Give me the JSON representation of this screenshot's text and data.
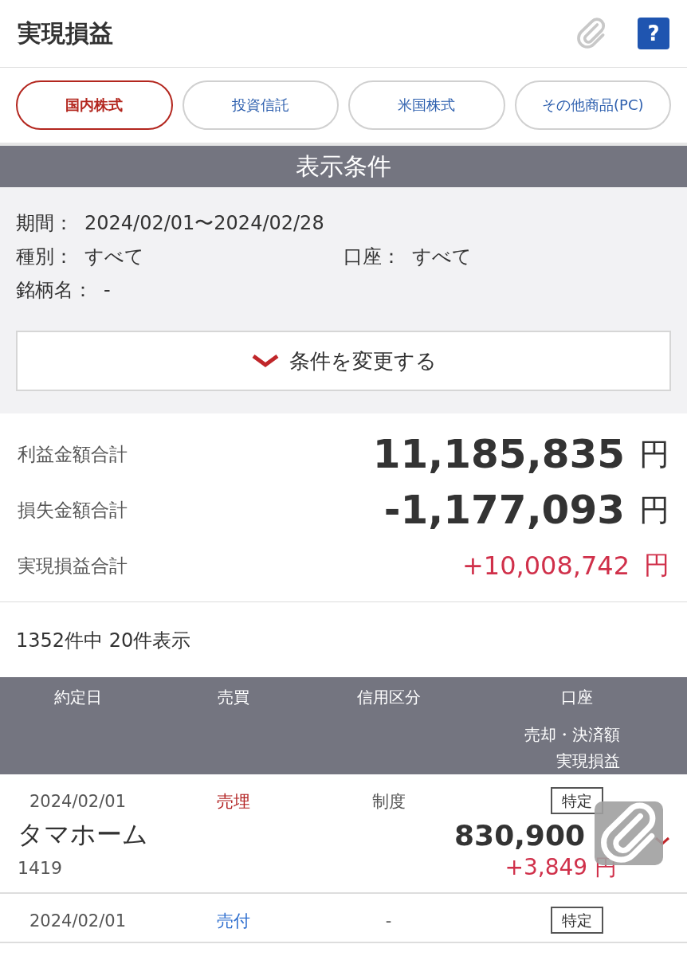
{
  "header": {
    "title": "実現損益",
    "help": "?"
  },
  "tabs": [
    {
      "label": "国内株式",
      "selected": true
    },
    {
      "label": "投資信託",
      "selected": false
    },
    {
      "label": "米国株式",
      "selected": false
    },
    {
      "label": "その他商品(PC)",
      "selected": false
    }
  ],
  "conditions": {
    "title": "表示条件",
    "period_label": "期間：",
    "period": "2024/02/01〜2024/02/28",
    "type_label": "種別：",
    "type": "すべて",
    "account_label": "口座：",
    "account": "すべて",
    "name_label": "銘柄名：",
    "name": "-",
    "change_button": "条件を変更する"
  },
  "totals": [
    {
      "label": "利益金額合計",
      "value": "11,185,835",
      "unit": "円",
      "kind": "large"
    },
    {
      "label": "損失金額合計",
      "value": "-1,177,093",
      "unit": "円",
      "kind": "large"
    },
    {
      "label": "実現損益合計",
      "value": "+10,008,742",
      "unit": "円",
      "kind": "signed"
    }
  ],
  "count": "1352件中 20件表示",
  "table": {
    "columns": [
      "約定日",
      "売買",
      "信用区分",
      "口座"
    ],
    "sub_columns": [
      "売却・決済額",
      "実現損益"
    ],
    "rows": [
      {
        "date": "2024/02/01",
        "trade": {
          "text": "売埋",
          "color": "#b22222"
        },
        "credit": "制度",
        "account": "特定",
        "name": "タマホーム",
        "code": "1419",
        "amount": "830,900",
        "profit": "+3,849",
        "profit_unit": "円"
      },
      {
        "date": "2024/02/01",
        "trade": {
          "text": "売付",
          "color": "#2f6fcf"
        },
        "credit": "-",
        "account": "特定"
      }
    ]
  }
}
